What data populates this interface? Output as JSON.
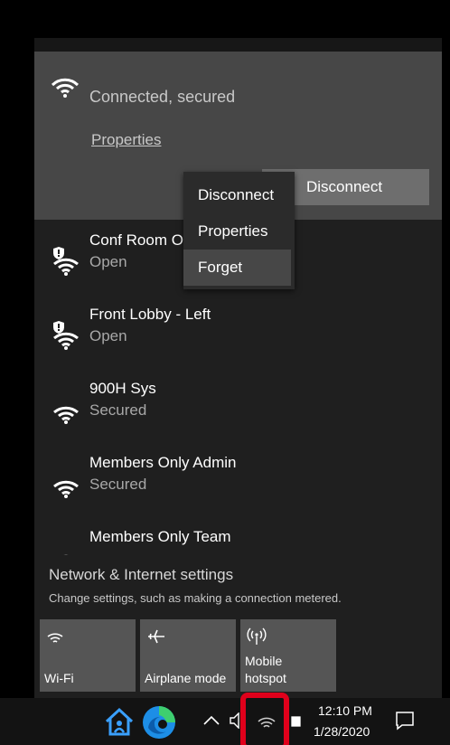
{
  "connected": {
    "status": "Connected, secured",
    "properties_link": "Properties",
    "disconnect_button": "Disconnect"
  },
  "context_menu": {
    "items": [
      "Disconnect",
      "Properties",
      "Forget"
    ],
    "hovered": "Forget"
  },
  "networks": [
    {
      "name": "Conf Room O",
      "status": "Open",
      "icon": "wifi-open-shield-icon"
    },
    {
      "name": "Front Lobby - Left",
      "status": "Open",
      "icon": "wifi-open-shield-icon"
    },
    {
      "name": "900H Sys",
      "status": "Secured",
      "icon": "wifi-icon"
    },
    {
      "name": "Members Only Admin",
      "status": "Secured",
      "icon": "wifi-icon"
    },
    {
      "name": "Members Only Team",
      "status": "",
      "icon": "wifi-icon"
    }
  ],
  "settings": {
    "title": "Network & Internet settings",
    "description": "Change settings, such as making a connection metered."
  },
  "quick_actions": [
    {
      "label": "Wi-Fi",
      "icon": "wifi-icon"
    },
    {
      "label": "Airplane mode",
      "icon": "airplane-icon"
    },
    {
      "label": "Mobile\nhotspot",
      "icon": "hotspot-icon"
    }
  ],
  "taskbar": {
    "time": "12:10 PM",
    "date": "1/28/2020"
  },
  "colors": {
    "highlight": "#e0001b",
    "connected_bg": "#474747",
    "flyout_bg": "#1f1f1f"
  }
}
